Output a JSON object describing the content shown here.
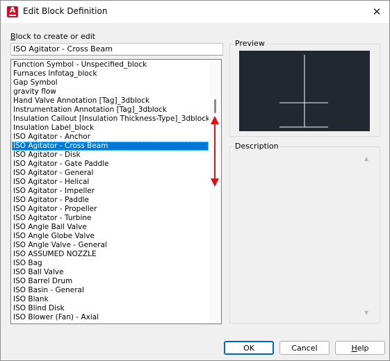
{
  "window": {
    "title": "Edit Block Definition",
    "app_icon_letter": "A",
    "close_glyph": "✕"
  },
  "block_field": {
    "label_mnemonic": "B",
    "label_rest": "lock to create or edit",
    "value": "ISO Agitator - Cross Beam"
  },
  "block_list": {
    "items": [
      "Function Symbol - Unspecified_block",
      "Furnaces Infotag_block",
      "Gap Symbol",
      "gravity flow",
      "Hand Valve Annotation [Tag]_3dblock",
      "Instrumentation Annotation [Tag]_3dblock",
      "Insulation Callout [Insulation Thickness-Type]_3dblock",
      "Insulation Label_block",
      "ISO Agitator - Anchor",
      "ISO Agitator - Cross Beam",
      "ISO Agitator - Disk",
      "ISO Agitator - Gate Paddle",
      "ISO Agitator - General",
      "ISO Agitator - Helical",
      "ISO Agitator - Impeller",
      "ISO Agitator - Paddle",
      "ISO Agitator - Propeller",
      "ISO Agitator - Turbine",
      "ISO Angle Ball Valve",
      "ISO Angle Globe Valve",
      "ISO Angle Valve - General",
      "ISO ASSUMED NOZZLE",
      "ISO Bag",
      "ISO Ball Valve",
      "ISO Barrel Drum",
      "ISO Basin - General",
      "ISO Blank",
      "ISO Blind Disk",
      "ISO Blower (Fan) - Axial"
    ],
    "selected_index": 9
  },
  "preview": {
    "label": "Preview"
  },
  "description": {
    "label": "Description",
    "value": ""
  },
  "buttons": {
    "ok": "OK",
    "cancel": "Cancel",
    "help_mnemonic": "H",
    "help_rest": "elp"
  },
  "colors": {
    "selection": "#0078d7",
    "preview_bg": "#212830",
    "annotation_arrow": "#e01010",
    "app_icon": "#c8102e"
  }
}
